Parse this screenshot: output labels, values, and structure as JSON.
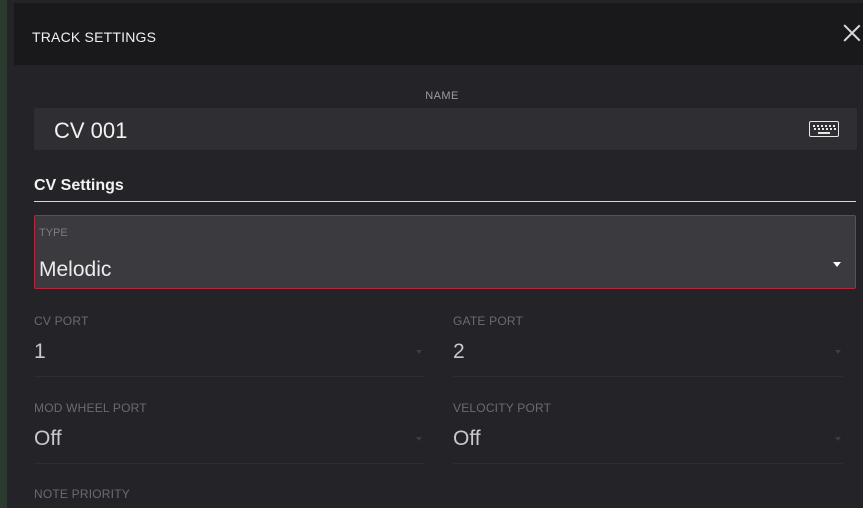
{
  "dialog": {
    "title": "TRACK SETTINGS"
  },
  "name": {
    "label": "NAME",
    "value": "CV 001"
  },
  "cv_settings": {
    "heading": "CV Settings",
    "type": {
      "label": "TYPE",
      "value": "Melodic"
    },
    "cv_port": {
      "label": "CV PORT",
      "value": "1"
    },
    "gate_port": {
      "label": "GATE PORT",
      "value": "2"
    },
    "mod_wheel_port": {
      "label": "MOD WHEEL PORT",
      "value": "Off"
    },
    "velocity_port": {
      "label": "VELOCITY PORT",
      "value": "Off"
    },
    "note_priority": {
      "label": "NOTE PRIORITY"
    }
  },
  "colors": {
    "accent_border": "#b5273c",
    "background": "#242428",
    "titlebar": "#19191b"
  },
  "icons": [
    "close-icon",
    "keyboard-icon",
    "caret-down-icon"
  ]
}
